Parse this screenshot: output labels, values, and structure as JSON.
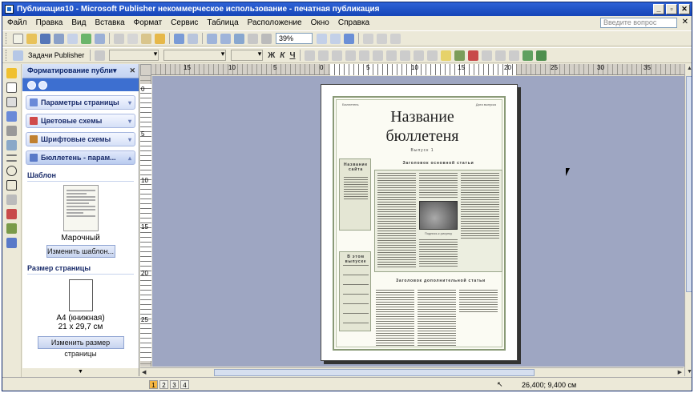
{
  "title": "Публикация10 - Microsoft Publisher некоммерческое использование - печатная публикация",
  "window_buttons": {
    "minimize": "_",
    "restore": "▫",
    "close": "✕"
  },
  "menu": [
    "Файл",
    "Правка",
    "Вид",
    "Вставка",
    "Формат",
    "Сервис",
    "Таблица",
    "Расположение",
    "Окно",
    "Справка"
  ],
  "help_placeholder": "Введите вопрос",
  "help_close": "✕",
  "zoom": "39%",
  "tasks_label": "Задачи Publisher",
  "format_glyphs": {
    "bold": "Ж",
    "italic": "К",
    "underline": "Ч"
  },
  "taskpane": {
    "title": "Форматирование публи▾",
    "close": "✕",
    "sections": [
      {
        "label": "Параметры страницы",
        "color": "#6a8ad8"
      },
      {
        "label": "Цветовые схемы",
        "color": "#d04a4a"
      },
      {
        "label": "Шрифтовые схемы",
        "color": "#c08030"
      },
      {
        "label": "Бюллетень - парам...",
        "color": "#5a7ac8"
      }
    ],
    "template_label": "Шаблон",
    "template_name": "Марочный",
    "change_template": "Изменить шаблон...",
    "pagesize_label": "Размер страницы",
    "pagesize_name": "А4 (книжная)",
    "pagesize_dims": "21 x 29,7 см",
    "change_size": "Изменить размер страницы"
  },
  "ruler_h": [
    "15",
    "10",
    "5",
    "0",
    "5",
    "10",
    "15",
    "20",
    "25",
    "30",
    "35"
  ],
  "ruler_v": [
    "0",
    "5",
    "10",
    "15",
    "20",
    "25"
  ],
  "publication": {
    "title_line1": "Название",
    "title_line2": "бюллетеня",
    "header_left": "Бюллетень",
    "header_right": "Дата выпуска",
    "issue": "Выпуск 1",
    "sidebar_head": "Название сайта",
    "inside_head": "В этом выпуске",
    "main_head": "Заголовок основной статьи",
    "photo_caption": "Подпись к рисунку",
    "secondary_head": "Заголовок дополнительной статьи"
  },
  "pages": [
    "1",
    "2",
    "3",
    "4"
  ],
  "coordinates": "26,400; 9,400 см"
}
